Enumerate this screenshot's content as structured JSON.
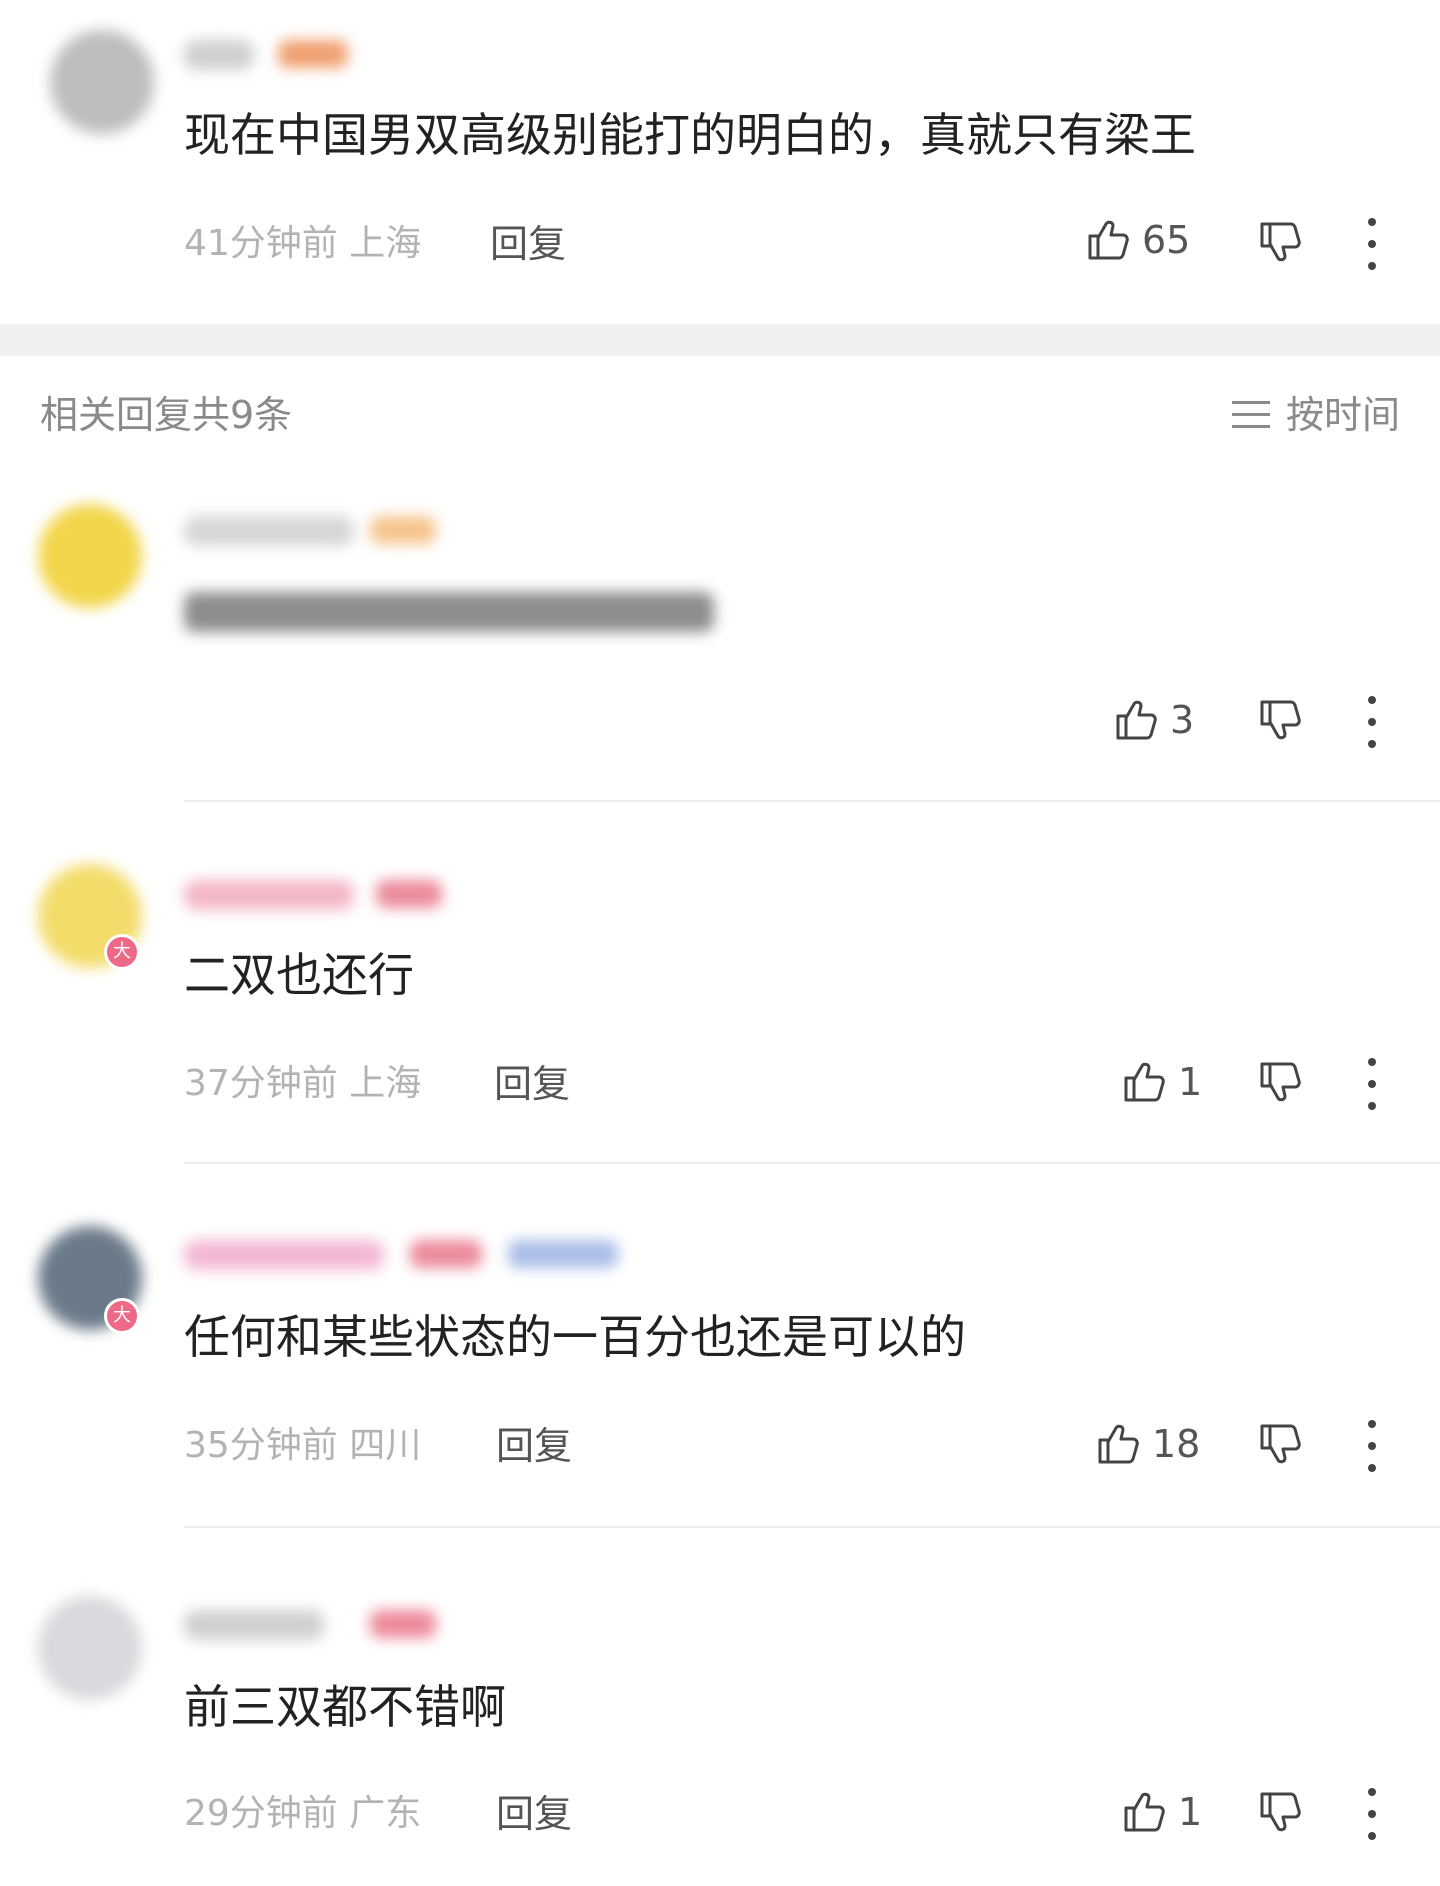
{
  "top_comment": {
    "text": "现在中国男双高级别能打的明白的，真就只有梁王",
    "time_location": "41分钟前 上海",
    "reply_label": "回复",
    "likes": "65"
  },
  "replies_header": {
    "count_label": "相关回复共9条",
    "sort_label": "按时间"
  },
  "replies": [
    {
      "likes": "3"
    },
    {
      "text": "二双也还行",
      "time_location": "37分钟前 上海",
      "reply_label": "回复",
      "likes": "1",
      "badge": "大"
    },
    {
      "text": "任何和某些状态的一百分也还是可以的",
      "time_location": "35分钟前 四川",
      "reply_label": "回复",
      "likes": "18",
      "badge": "大"
    },
    {
      "text": "前三双都不错啊",
      "time_location": "29分钟前 广东",
      "reply_label": "回复",
      "likes": "1"
    }
  ],
  "colors": {
    "text": "#222222",
    "meta": "#b3b3b3",
    "section_bg": "#eef0f2",
    "badge_pink": "#ec6a87"
  },
  "icons": [
    "thumbs-up-icon",
    "thumbs-down-icon",
    "more-vertical-icon",
    "sort-lines-icon"
  ]
}
